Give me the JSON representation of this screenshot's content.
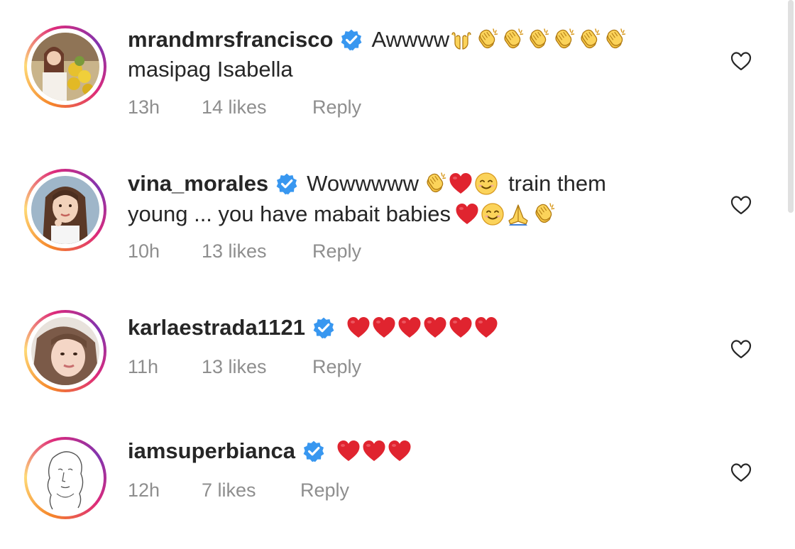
{
  "comments": [
    {
      "username": "mrandmrsfrancisco",
      "verified": true,
      "text_line1": "Awwww",
      "emojis_line1": [
        "raised-hands",
        "clap",
        "clap",
        "clap",
        "clap",
        "clap",
        "clap"
      ],
      "text_line2": "masipag Isabella",
      "emojis_line2": [],
      "time": "13h",
      "likes": "14 likes",
      "reply": "Reply",
      "avatar_ring": "gradient"
    },
    {
      "username": "vina_morales",
      "verified": true,
      "text_line1": "Wowwwww",
      "emojis_line1": [
        "clap",
        "red-heart",
        "smiling-face"
      ],
      "text_line1_after": "train them",
      "text_line2": "young ... you have mabait babies",
      "emojis_line2": [
        "red-heart",
        "smiling-face",
        "folded-hands",
        "clap"
      ],
      "time": "10h",
      "likes": "13 likes",
      "reply": "Reply",
      "avatar_ring": "gradient"
    },
    {
      "username": "karlaestrada1121",
      "verified": true,
      "text_line1": "",
      "emojis_line1": [
        "red-heart",
        "red-heart",
        "red-heart",
        "red-heart",
        "red-heart",
        "red-heart"
      ],
      "time": "11h",
      "likes": "13 likes",
      "reply": "Reply",
      "avatar_ring": "gradient"
    },
    {
      "username": "iamsuperbianca",
      "verified": true,
      "text_line1": "",
      "emojis_line1": [
        "red-heart",
        "red-heart",
        "red-heart"
      ],
      "time": "12h",
      "likes": "7 likes",
      "reply": "Reply",
      "avatar_ring": "gradient"
    }
  ],
  "colors": {
    "text": "#262626",
    "meta": "#8e8e8e",
    "verified_blue": "#3897f0",
    "heart_red": "#e0242f",
    "ring_start": "#f58529",
    "ring_mid": "#dd2a7b"
  },
  "icons": {
    "verified": "verified-badge-icon",
    "like": "heart-outline-icon"
  }
}
